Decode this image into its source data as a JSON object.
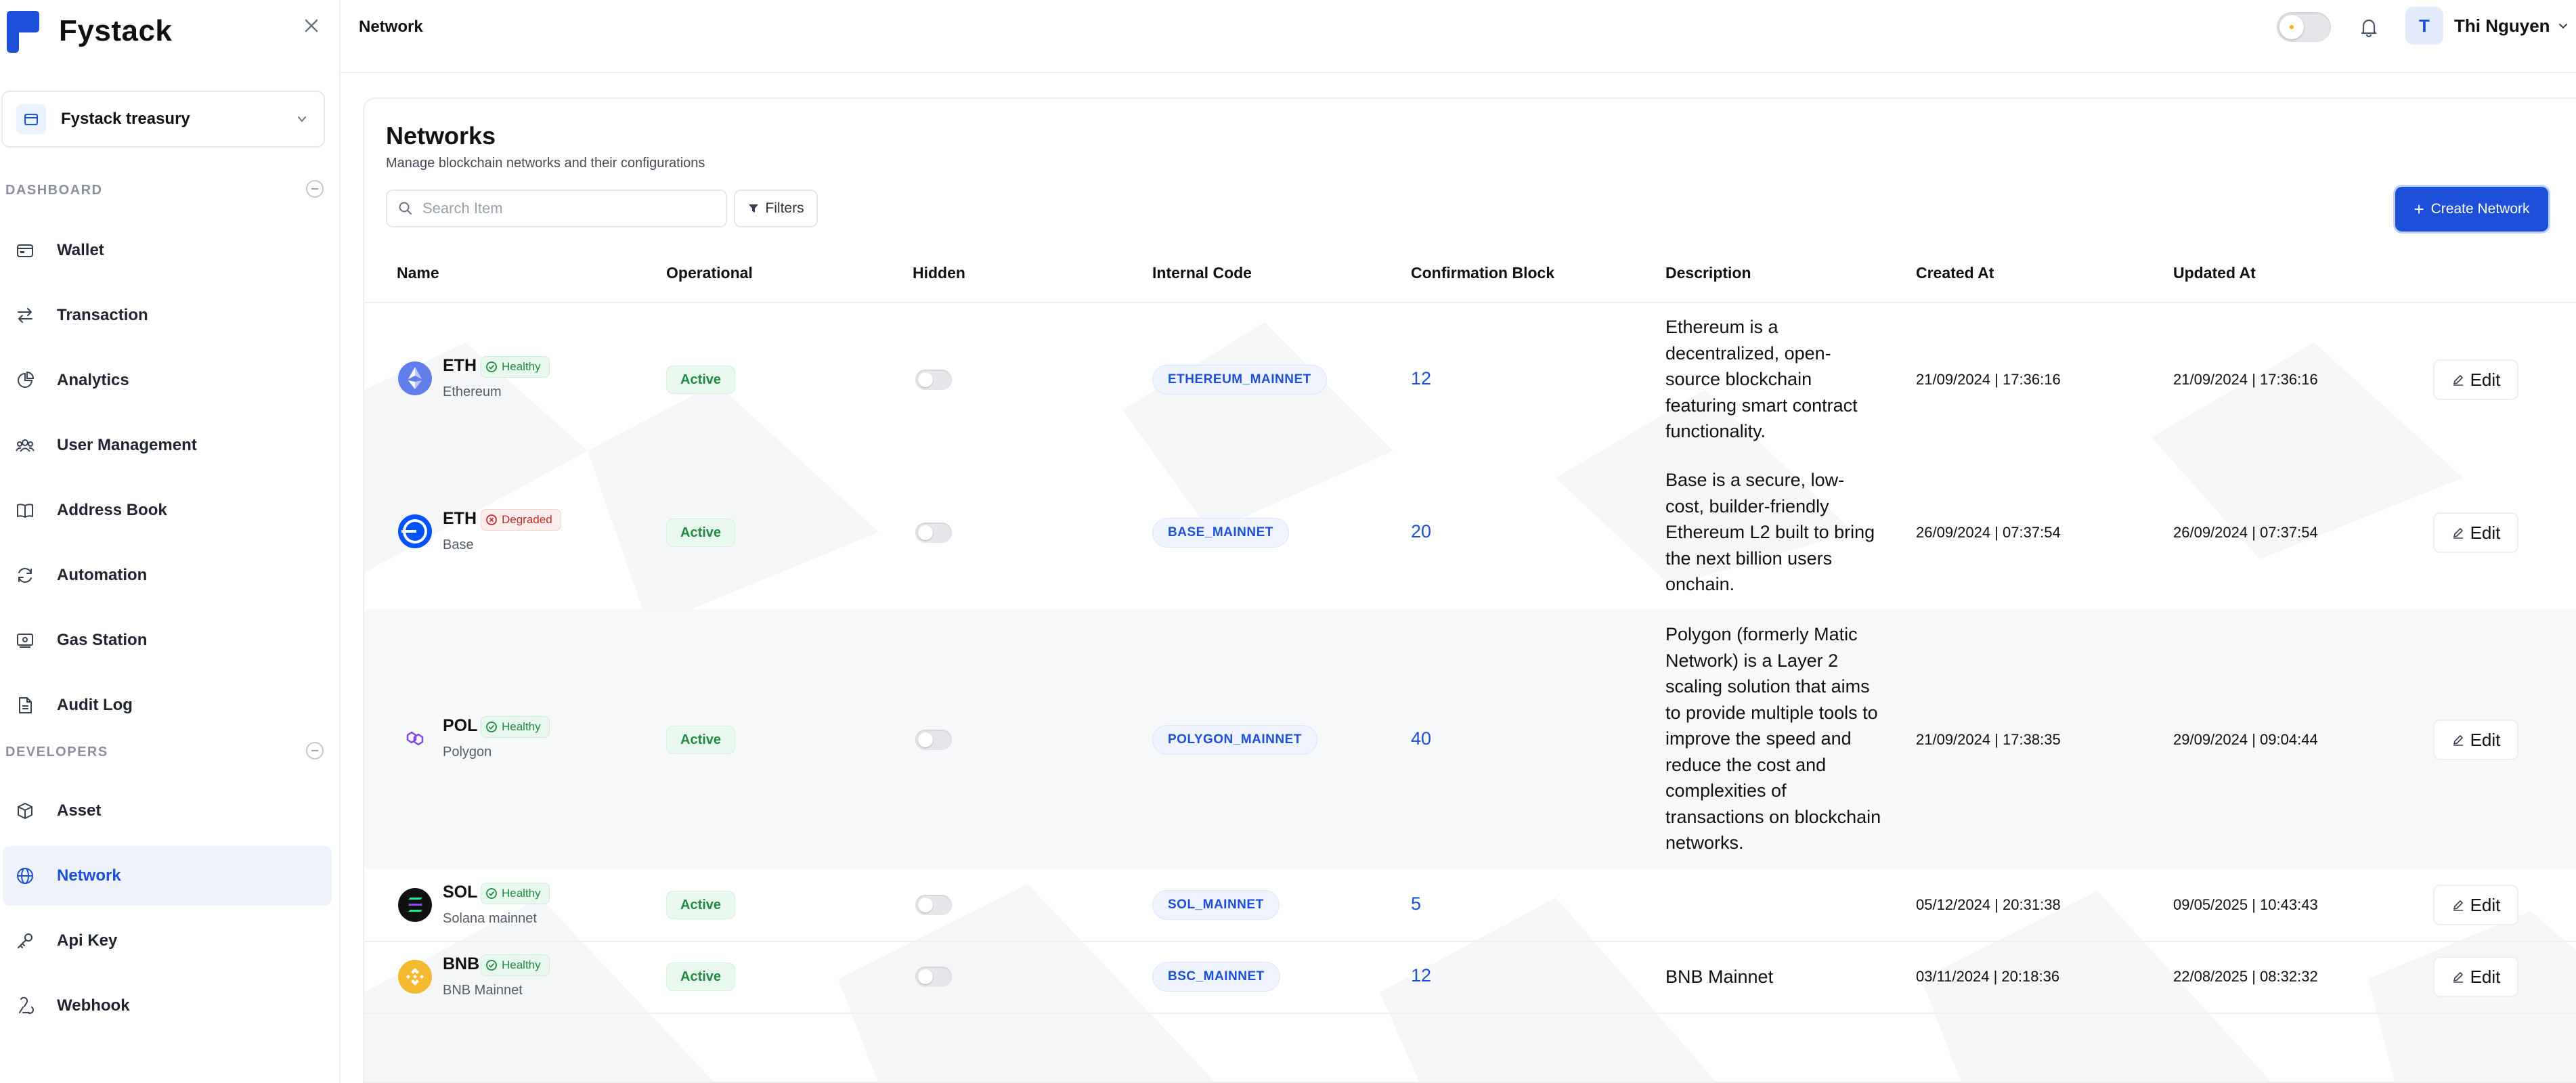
{
  "app": {
    "name": "Fystack"
  },
  "workspace": {
    "name": "Fystack treasury"
  },
  "sidebar": {
    "sections": [
      {
        "label": "DASHBOARD",
        "items": [
          {
            "label": "Wallet",
            "icon": "wallet-icon"
          },
          {
            "label": "Transaction",
            "icon": "transfer-icon"
          },
          {
            "label": "Analytics",
            "icon": "pie-chart-icon"
          },
          {
            "label": "User Management",
            "icon": "users-icon"
          },
          {
            "label": "Address Book",
            "icon": "book-icon"
          },
          {
            "label": "Automation",
            "icon": "refresh-icon"
          },
          {
            "label": "Gas Station",
            "icon": "gas-station-icon"
          },
          {
            "label": "Audit Log",
            "icon": "document-icon"
          }
        ]
      },
      {
        "label": "DEVELOPERS",
        "items": [
          {
            "label": "Asset",
            "icon": "cube-icon"
          },
          {
            "label": "Network",
            "icon": "globe-icon",
            "active": true
          },
          {
            "label": "Api Key",
            "icon": "key-icon"
          },
          {
            "label": "Webhook",
            "icon": "webhook-icon"
          }
        ]
      }
    ]
  },
  "topbar": {
    "title": "Network",
    "user": {
      "initial": "T",
      "name": "Thi Nguyen"
    }
  },
  "page": {
    "title": "Networks",
    "subtitle": "Manage blockchain networks and their configurations",
    "search_placeholder": "Search Item",
    "filters_label": "Filters",
    "create_label": "Create Network"
  },
  "table": {
    "columns": [
      "Name",
      "Operational",
      "Hidden",
      "Internal Code",
      "Confirmation Block",
      "Description",
      "Created At",
      "Updated At"
    ],
    "rows": [
      {
        "symbol": "ETH",
        "name": "Ethereum",
        "health": "Healthy",
        "status": "Active",
        "code": "ETHEREUM_MAINNET",
        "confirmations": "12",
        "description": "Ethereum is a decentralized, open-source blockchain featuring smart contract functionality.",
        "created": "21/09/2024 | 17:36:16",
        "updated": "21/09/2024 | 17:36:16",
        "edit": "Edit"
      },
      {
        "symbol": "ETH",
        "name": "Base",
        "health": "Degraded",
        "status": "Active",
        "code": "BASE_MAINNET",
        "confirmations": "20",
        "description": "Base is a secure, low-cost, builder-friendly Ethereum L2 built to bring the next billion users onchain.",
        "created": "26/09/2024 | 07:37:54",
        "updated": "26/09/2024 | 07:37:54",
        "edit": "Edit"
      },
      {
        "symbol": "POL",
        "name": "Polygon",
        "health": "Healthy",
        "status": "Active",
        "code": "POLYGON_MAINNET",
        "confirmations": "40",
        "description": "Polygon (formerly Matic Network) is a Layer 2 scaling solution that aims to provide multiple tools to improve the speed and reduce the cost and complexities of transactions on blockchain networks.",
        "created": "21/09/2024 | 17:38:35",
        "updated": "29/09/2024 | 09:04:44",
        "edit": "Edit"
      },
      {
        "symbol": "SOL",
        "name": "Solana mainnet",
        "health": "Healthy",
        "status": "Active",
        "code": "SOL_MAINNET",
        "confirmations": "5",
        "description": "",
        "created": "05/12/2024 | 20:31:38",
        "updated": "09/05/2025 | 10:43:43",
        "edit": "Edit"
      },
      {
        "symbol": "BNB",
        "name": "BNB Mainnet",
        "health": "Healthy",
        "status": "Active",
        "code": "BSC_MAINNET",
        "confirmations": "12",
        "description": "BNB Mainnet",
        "created": "03/11/2024 | 20:18:36",
        "updated": "22/08/2025 | 08:32:32",
        "edit": "Edit"
      }
    ]
  },
  "colors": {
    "accent": "#1d4fd8",
    "healthy": "#1e8a43",
    "degraded": "#c62828"
  }
}
